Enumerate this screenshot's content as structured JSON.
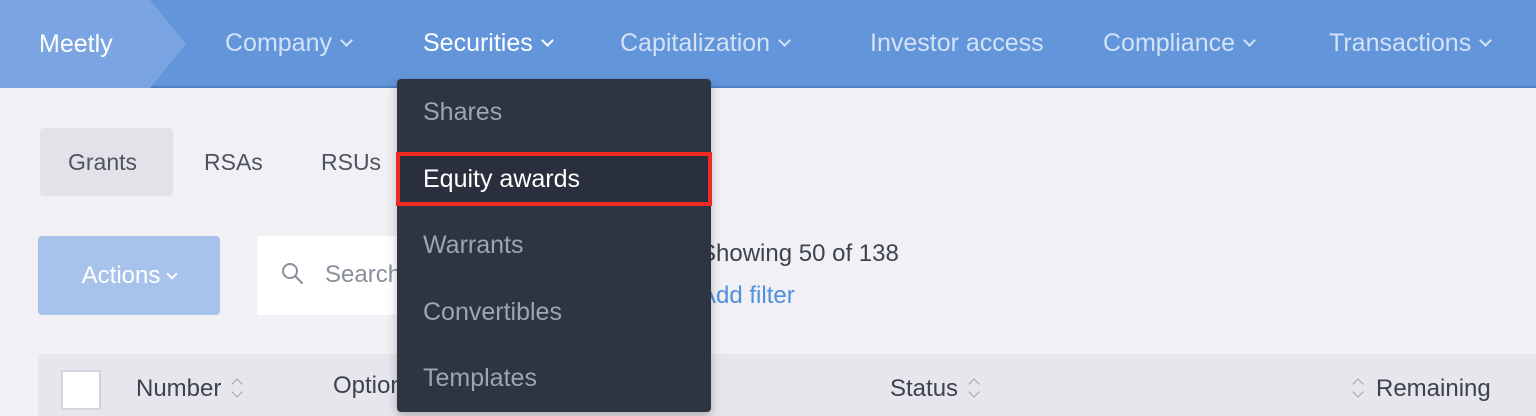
{
  "nav": {
    "brand": "Meetly",
    "items": [
      {
        "label": "Company",
        "has_menu": true
      },
      {
        "label": "Securities",
        "has_menu": true,
        "active": true
      },
      {
        "label": "Capitalization",
        "has_menu": true
      },
      {
        "label": "Investor access",
        "has_menu": false
      },
      {
        "label": "Compliance",
        "has_menu": true
      },
      {
        "label": "Transactions",
        "has_menu": true
      }
    ]
  },
  "subtabs": [
    {
      "label": "Grants",
      "active": true
    },
    {
      "label": "RSAs"
    },
    {
      "label": "RSUs"
    }
  ],
  "toolbar": {
    "actions_label": "Actions",
    "search_placeholder": "Search",
    "showing": "Showing 50 of 138",
    "add_filter": "Add filter"
  },
  "table": {
    "columns": [
      "Number",
      "Option",
      "Status",
      "Remaining"
    ]
  },
  "dropdown": {
    "items": [
      "Shares",
      "Equity awards",
      "Warrants",
      "Convertibles",
      "Templates"
    ],
    "highlighted": "Equity awards"
  },
  "colors": {
    "nav_bg": "#6395da",
    "dropdown_bg": "#2f3443",
    "highlight_border": "#ee2a24",
    "link": "#4f8fde"
  }
}
